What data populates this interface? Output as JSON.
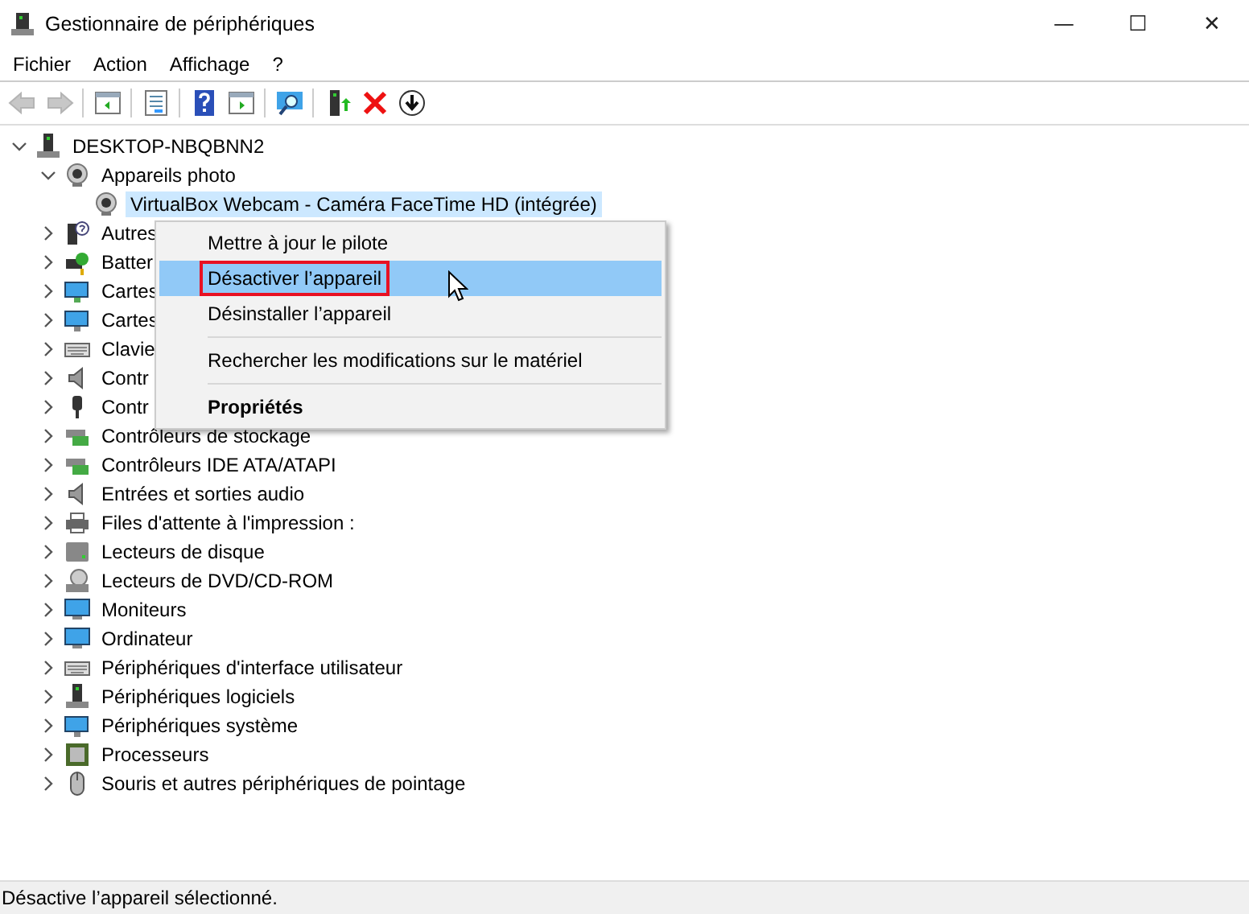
{
  "window": {
    "title": "Gestionnaire de périphériques",
    "controls": [
      "—",
      "☐",
      "✕"
    ]
  },
  "menu_bar": [
    "Fichier",
    "Action",
    "Affichage",
    "?"
  ],
  "toolbar": [
    {
      "kind": "back",
      "disabled": true
    },
    {
      "kind": "forward",
      "disabled": true
    },
    {
      "kind": "sep"
    },
    {
      "kind": "pane-left",
      "disabled": false
    },
    {
      "kind": "sep"
    },
    {
      "kind": "properties",
      "disabled": false
    },
    {
      "kind": "sep"
    },
    {
      "kind": "help",
      "disabled": false
    },
    {
      "kind": "pane-right",
      "disabled": false
    },
    {
      "kind": "sep"
    },
    {
      "kind": "scan",
      "disabled": false
    },
    {
      "kind": "sep"
    },
    {
      "kind": "update",
      "disabled": false
    },
    {
      "kind": "remove",
      "disabled": false
    },
    {
      "kind": "download",
      "disabled": false
    }
  ],
  "tree": [
    {
      "label": "DESKTOP-NBQBNN2",
      "kind": "computer",
      "expanded": true,
      "selected": false,
      "children": [
        {
          "label": "Appareils photo",
          "kind": "camera",
          "expanded": true,
          "selected": false,
          "children": [
            {
              "label": "VirtualBox Webcam - Caméra FaceTime HD (intégrée)",
              "kind": "camera",
              "selected": true
            }
          ]
        },
        {
          "label": "Autres",
          "kind": "unknown",
          "expanded": false,
          "selected": false
        },
        {
          "label": "Batter",
          "kind": "battery",
          "expanded": false,
          "selected": false
        },
        {
          "label": "Cartes",
          "kind": "card",
          "expanded": false,
          "selected": false
        },
        {
          "label": "Cartes",
          "kind": "network",
          "expanded": false,
          "selected": false
        },
        {
          "label": "Clavie",
          "kind": "keyboard",
          "expanded": false,
          "selected": false
        },
        {
          "label": "Contr",
          "kind": "speaker",
          "expanded": false,
          "selected": false
        },
        {
          "label": "Contr",
          "kind": "usb",
          "expanded": false,
          "selected": false
        },
        {
          "label": "Contrôleurs de stockage",
          "kind": "storage",
          "expanded": false,
          "selected": false
        },
        {
          "label": "Contrôleurs IDE ATA/ATAPI",
          "kind": "storage",
          "expanded": false,
          "selected": false
        },
        {
          "label": "Entrées et sorties audio",
          "kind": "speaker",
          "expanded": false,
          "selected": false
        },
        {
          "label": "Files d'attente à l'impression :",
          "kind": "printer",
          "expanded": false,
          "selected": false
        },
        {
          "label": "Lecteurs de disque",
          "kind": "disk",
          "expanded": false,
          "selected": false
        },
        {
          "label": "Lecteurs de DVD/CD-ROM",
          "kind": "dvd",
          "expanded": false,
          "selected": false
        },
        {
          "label": "Moniteurs",
          "kind": "monitor",
          "expanded": false,
          "selected": false
        },
        {
          "label": "Ordinateur",
          "kind": "monitor",
          "expanded": false,
          "selected": false
        },
        {
          "label": "Périphériques d'interface utilisateur",
          "kind": "keyboard",
          "expanded": false,
          "selected": false
        },
        {
          "label": "Périphériques logiciels",
          "kind": "computer",
          "expanded": false,
          "selected": false
        },
        {
          "label": "Périphériques système",
          "kind": "network",
          "expanded": false,
          "selected": false
        },
        {
          "label": "Processeurs",
          "kind": "chip",
          "expanded": false,
          "selected": false
        },
        {
          "label": "Souris et autres périphériques de pointage",
          "kind": "mouse",
          "expanded": false,
          "selected": false
        }
      ]
    }
  ],
  "context_menu": [
    {
      "kind": "item",
      "label": "Mettre à jour le pilote",
      "selected": false,
      "bold": false,
      "outlined": false
    },
    {
      "kind": "item",
      "label": "Désactiver l’appareil",
      "selected": true,
      "bold": false,
      "outlined": true
    },
    {
      "kind": "item",
      "label": "Désinstaller l’appareil",
      "selected": false,
      "bold": false,
      "outlined": false
    },
    {
      "kind": "sep"
    },
    {
      "kind": "item",
      "label": "Rechercher les modifications sur le matériel",
      "selected": false,
      "bold": false,
      "outlined": false
    },
    {
      "kind": "sep"
    },
    {
      "kind": "item",
      "label": "Propriétés",
      "selected": false,
      "bold": true,
      "outlined": false
    }
  ],
  "status_bar": "Désactive l’appareil sélectionné."
}
